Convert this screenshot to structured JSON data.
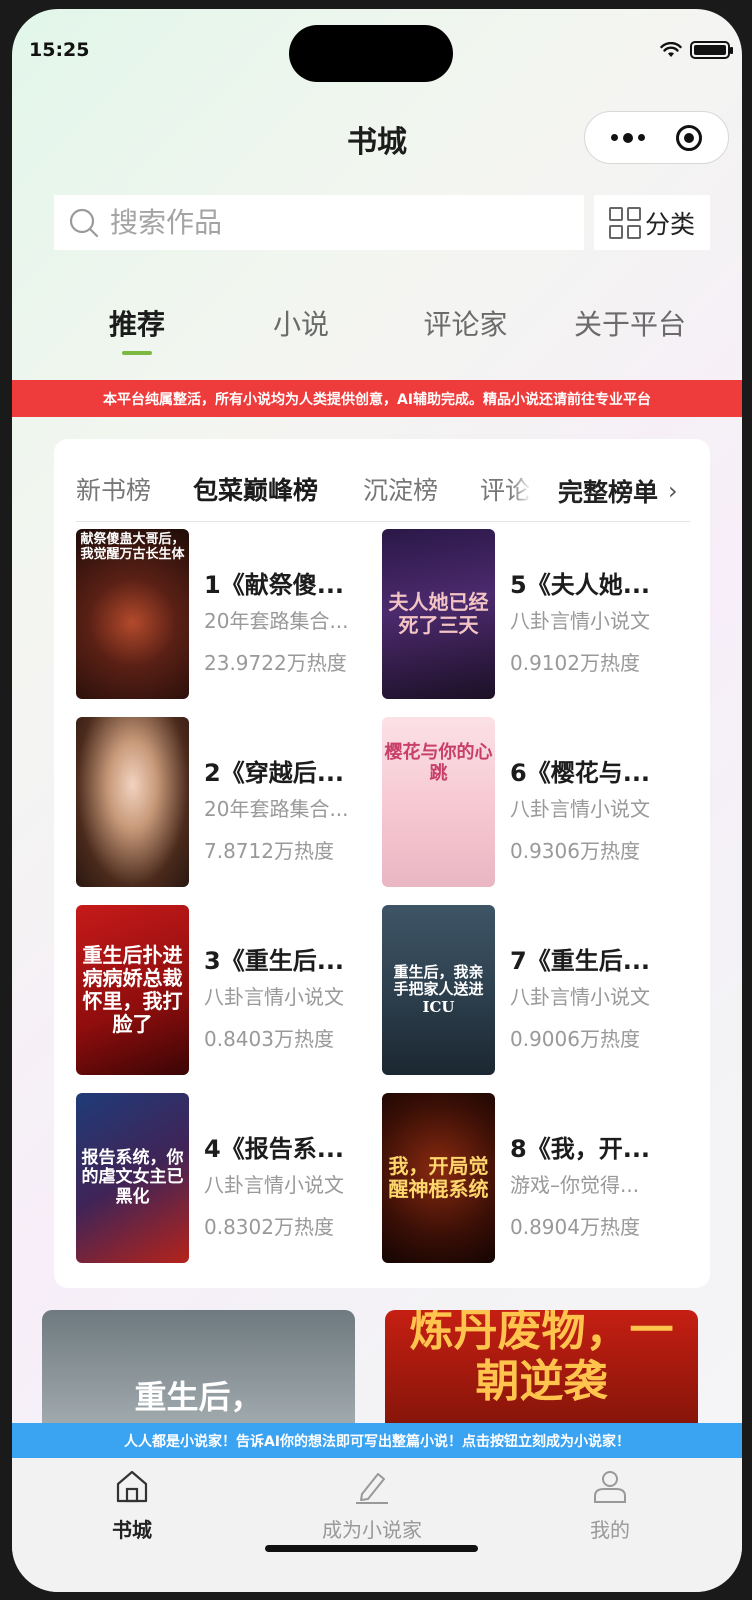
{
  "status": {
    "time": "15:25"
  },
  "header": {
    "title": "书城"
  },
  "search": {
    "placeholder": "搜索作品",
    "category_label": "分类"
  },
  "tabs": [
    {
      "label": "推荐",
      "active": true
    },
    {
      "label": "小说",
      "active": false
    },
    {
      "label": "评论家",
      "active": false
    },
    {
      "label": "关于平台",
      "active": false
    }
  ],
  "notice": "本平台纯属整活，所有小说均为人类提供创意，AI辅助完成。精品小说还请前往专业平台",
  "ranking": {
    "tabs": [
      "新书榜",
      "包菜巅峰榜",
      "沉淀榜",
      "评论"
    ],
    "active_tab": "包菜巅峰榜",
    "more_label": "完整榜单",
    "books": [
      {
        "rank": 1,
        "title": "1《献祭傻...",
        "author": "20年套路集合...",
        "heat": "23.9722万热度",
        "cover_text": "献祭傻蛊大哥后，我觉醒万古长生体"
      },
      {
        "rank": 2,
        "title": "2《穿越后...",
        "author": "20年套路集合...",
        "heat": "7.8712万热度",
        "cover_text": ""
      },
      {
        "rank": 3,
        "title": "3《重生后...",
        "author": "八卦言情小说文",
        "heat": "0.8403万热度",
        "cover_text": "重生后扑进病病娇总裁怀里，我打脸了"
      },
      {
        "rank": 4,
        "title": "4《报告系...",
        "author": "八卦言情小说文",
        "heat": "0.8302万热度",
        "cover_text": "报告系统，你的虐文女主已黑化"
      },
      {
        "rank": 5,
        "title": "5《夫人她...",
        "author": "八卦言情小说文",
        "heat": "0.9102万热度",
        "cover_text": "夫人她已经死了三天"
      },
      {
        "rank": 6,
        "title": "6《樱花与...",
        "author": "八卦言情小说文",
        "heat": "0.9306万热度",
        "cover_text": "樱花与你的心跳"
      },
      {
        "rank": 7,
        "title": "7《重生后...",
        "author": "八卦言情小说文",
        "heat": "0.9006万热度",
        "cover_text": "重生后，我亲手把家人送进ICU"
      },
      {
        "rank": 8,
        "title": "8《我，开...",
        "author": "游戏–你觉得...",
        "heat": "0.8904万热度",
        "cover_text": "我，开局觉醒神棍系统"
      }
    ]
  },
  "lower_cards": [
    {
      "cover_text": "重生后，"
    },
    {
      "cover_text": "炼丹废物，一朝逆袭"
    }
  ],
  "banner": "人人都是小说家！告诉AI你的想法即可写出整篇小说！点击按钮立刻成为小说家！",
  "tabbar": [
    {
      "label": "书城",
      "icon": "home-icon",
      "active": true
    },
    {
      "label": "成为小说家",
      "icon": "pen-icon",
      "active": false
    },
    {
      "label": "我的",
      "icon": "user-icon",
      "active": false
    }
  ],
  "colors": {
    "accent": "#7db843",
    "notice_red": "#ee3b3b",
    "banner_blue": "#3aa3f2"
  }
}
